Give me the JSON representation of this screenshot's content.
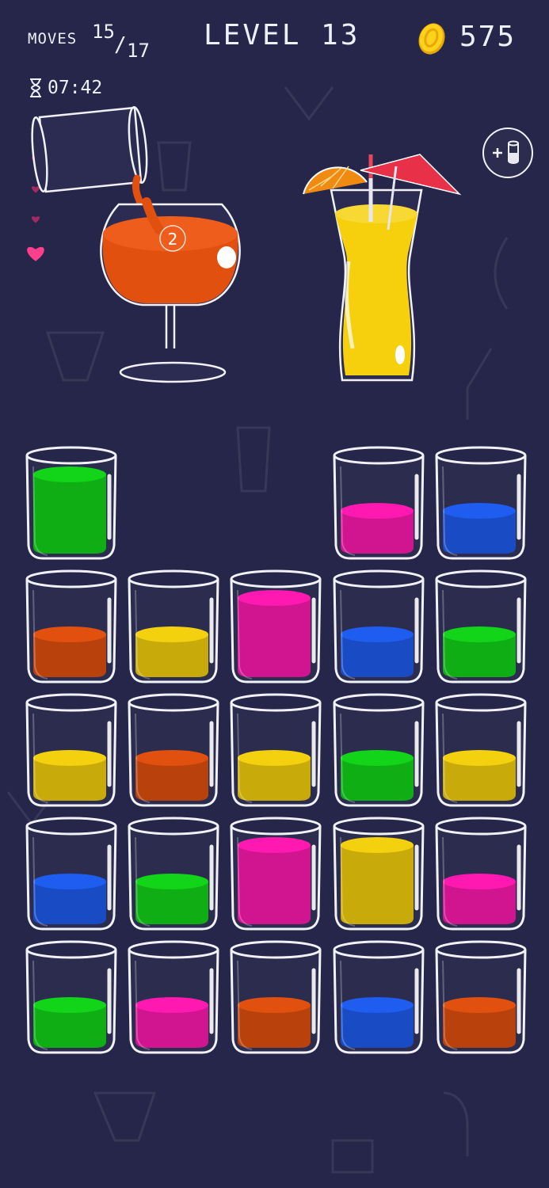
{
  "hud": {
    "moves_label": "MOVES",
    "moves_current": "15",
    "moves_slash": "/",
    "moves_total": "17",
    "level_title": "LEVEL 13",
    "coins": "575",
    "timer": "07:42"
  },
  "lives": {
    "total": 5,
    "filled": 1
  },
  "pour": {
    "count_badge": "2",
    "color": "#e2500f"
  },
  "colors": {
    "green": "#12d418",
    "pink": "#ff19b1",
    "blue": "#1f5cf0",
    "orange": "#e2500f",
    "yellow": "#f4d10e",
    "background": "#26264a"
  },
  "tubes": [
    {
      "id": "r1c1",
      "liquid": "green",
      "fill": 2
    },
    {
      "id": "r1c4",
      "liquid": "pink",
      "fill": 1
    },
    {
      "id": "r1c5",
      "liquid": "blue",
      "fill": 1
    },
    {
      "id": "r2c1",
      "liquid": "orange",
      "fill": 1
    },
    {
      "id": "r2c2",
      "liquid": "yellow",
      "fill": 1
    },
    {
      "id": "r2c3",
      "liquid": "pink",
      "fill": 2
    },
    {
      "id": "r2c4",
      "liquid": "blue",
      "fill": 1
    },
    {
      "id": "r2c5",
      "liquid": "green",
      "fill": 1
    },
    {
      "id": "r3c1",
      "liquid": "yellow",
      "fill": 1
    },
    {
      "id": "r3c2",
      "liquid": "orange",
      "fill": 1
    },
    {
      "id": "r3c3",
      "liquid": "yellow",
      "fill": 1
    },
    {
      "id": "r3c4",
      "liquid": "green",
      "fill": 1
    },
    {
      "id": "r3c5",
      "liquid": "yellow",
      "fill": 1
    },
    {
      "id": "r4c1",
      "liquid": "blue",
      "fill": 1
    },
    {
      "id": "r4c2",
      "liquid": "green",
      "fill": 1
    },
    {
      "id": "r4c3",
      "liquid": "pink",
      "fill": 2
    },
    {
      "id": "r4c4",
      "liquid": "yellow",
      "fill": 2
    },
    {
      "id": "r4c5",
      "liquid": "pink",
      "fill": 1
    },
    {
      "id": "r5c1",
      "liquid": "green",
      "fill": 1
    },
    {
      "id": "r5c2",
      "liquid": "pink",
      "fill": 1
    },
    {
      "id": "r5c3",
      "liquid": "orange",
      "fill": 1
    },
    {
      "id": "r5c4",
      "liquid": "blue",
      "fill": 1
    },
    {
      "id": "r5c5",
      "liquid": "orange",
      "fill": 1
    }
  ]
}
